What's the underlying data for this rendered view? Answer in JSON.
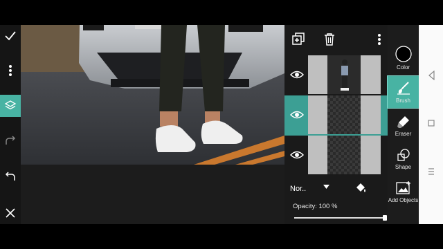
{
  "blend": {
    "mode_label": "Nor.."
  },
  "opacity": {
    "label": "Opacity: 100 %",
    "value_percent": 100
  },
  "tools": [
    {
      "label": "Color",
      "icon": "color-circle-icon"
    },
    {
      "label": "Brush",
      "icon": "brush-icon",
      "active": true
    },
    {
      "label": "Eraser",
      "icon": "eraser-icon"
    },
    {
      "label": "Shape",
      "icon": "shape-icon"
    },
    {
      "label": "Add Objects",
      "icon": "add-objects-icon"
    }
  ],
  "left_toolbar": [
    "check-icon",
    "more-vertical-icon",
    "layers-icon",
    "redo-icon",
    "undo-icon",
    "close-icon"
  ],
  "layers_toolbar": [
    "add-layer-icon",
    "delete-icon",
    "more-vertical-icon"
  ],
  "colors": {
    "accent": "#48b3a3",
    "panel": "#1a1a1a",
    "selected_layer": "#3c9f94"
  }
}
